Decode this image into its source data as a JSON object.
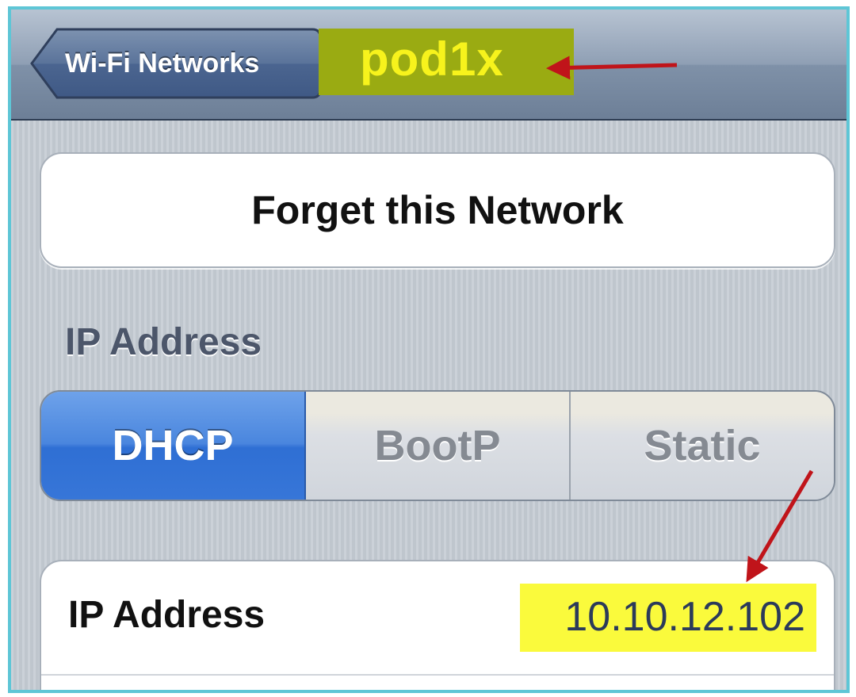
{
  "navbar": {
    "back_label": "Wi-Fi Networks",
    "title": "pod1x",
    "title_highlight_color": "#9aab12",
    "title_text_color": "#f7f31c"
  },
  "actions": {
    "forget_label": "Forget this Network"
  },
  "ip_section": {
    "header": "IP Address",
    "segments": [
      {
        "label": "DHCP",
        "selected": true
      },
      {
        "label": "BootP",
        "selected": false
      },
      {
        "label": "Static",
        "selected": false
      }
    ],
    "selected_color": "#3776d8",
    "rows": [
      {
        "label": "IP Address",
        "value": "10.10.12.102"
      }
    ],
    "value_highlight_color": "#fafa3c"
  },
  "annotations": {
    "arrow_color": "#c0141a"
  }
}
